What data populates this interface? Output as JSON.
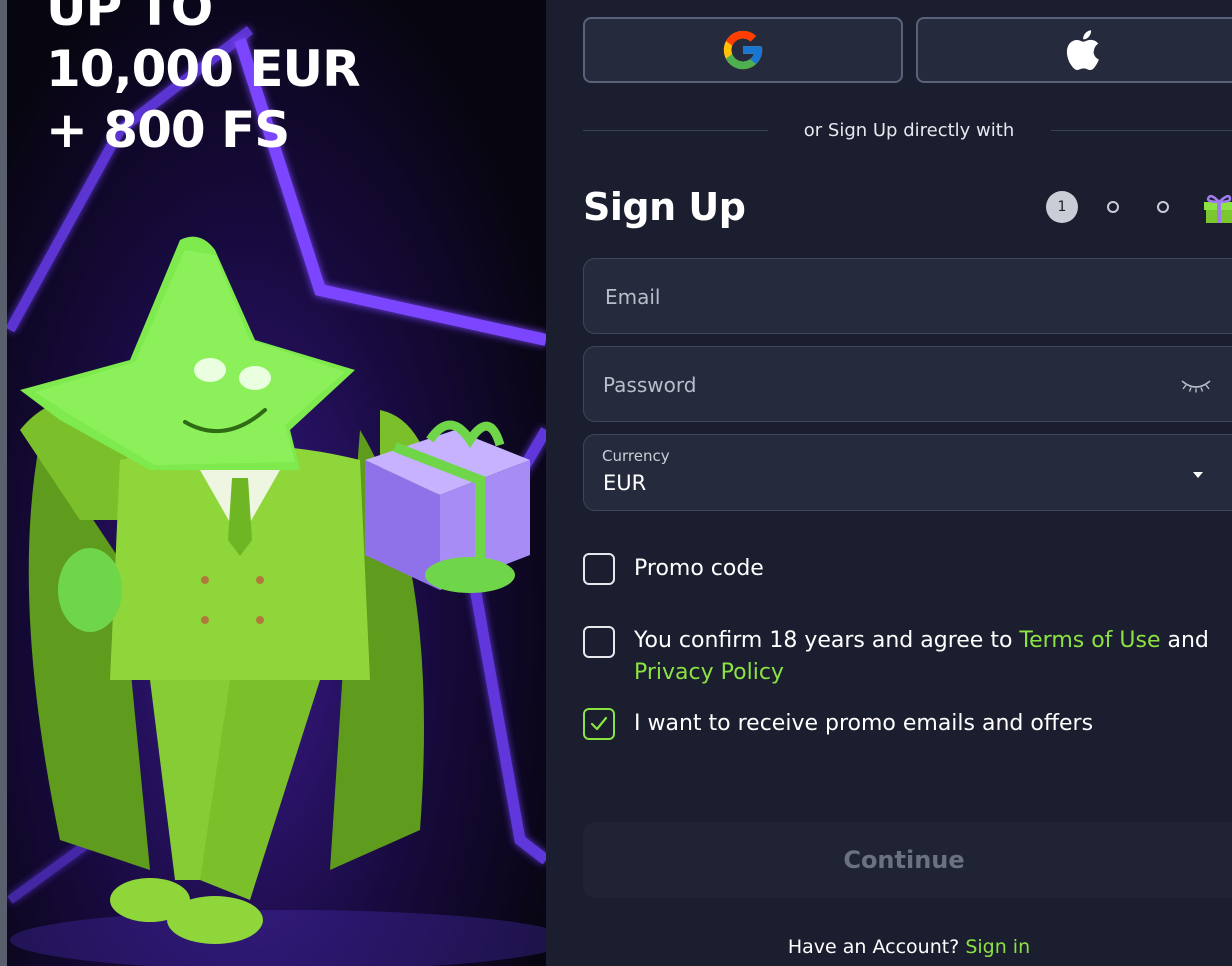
{
  "promo": {
    "headline_lines": [
      "UP TO",
      "10,000 EUR",
      "+ 800 FS"
    ]
  },
  "social": {
    "google_icon": "google-g-icon",
    "apple_icon": "apple-logo-icon"
  },
  "divider": {
    "text": "or Sign Up directly with"
  },
  "signup": {
    "title": "Sign Up",
    "steps": {
      "current": "1",
      "total_dots": 2,
      "final_icon": "gift-icon"
    }
  },
  "form": {
    "email_placeholder": "Email",
    "password_placeholder": "Password",
    "currency": {
      "label": "Currency",
      "value": "EUR"
    }
  },
  "checkboxes": {
    "promo_code": {
      "label": "Promo code",
      "checked": false
    },
    "terms": {
      "text_before": "You confirm 18 years and agree to ",
      "terms_link": "Terms of Use",
      "text_and": " and",
      "privacy_link": "Privacy Policy",
      "checked": false
    },
    "promo_emails": {
      "label": "I want to receive promo emails and offers",
      "checked": true
    }
  },
  "actions": {
    "continue_label": "Continue",
    "have_account_text": "Have an Account?",
    "sign_in_label": "Sign in"
  },
  "colors": {
    "accent": "#8de243",
    "panel_bg": "#1a1e2e",
    "field_bg": "#252b3d",
    "button_disabled_bg": "#1f2333"
  }
}
